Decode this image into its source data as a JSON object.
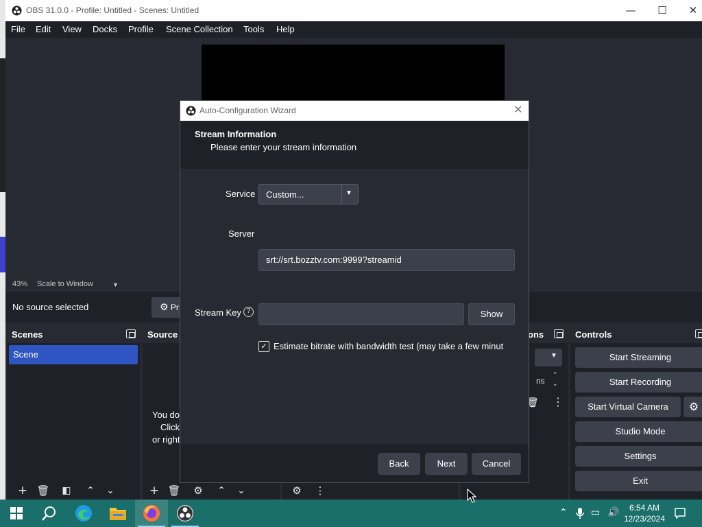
{
  "window": {
    "title": "OBS 31.0.0 - Profile: Untitled - Scenes: Untitled",
    "minimize": "—",
    "maximize": "☐",
    "close": "✕"
  },
  "menu": [
    "File",
    "Edit",
    "View",
    "Docks",
    "Profile",
    "Scene Collection",
    "Tools",
    "Help"
  ],
  "preview": {
    "zoom": "43%",
    "scale_mode": "Scale to Window",
    "caret": "▼"
  },
  "source_bar": {
    "no_source": "No source selected",
    "properties_partial": "Pr"
  },
  "docks": {
    "scenes_title": "Scenes",
    "scene_item": "Scene",
    "sources_title": "Source",
    "sources_empty": [
      "You do",
      "Click",
      "or right"
    ],
    "transitions_title_partial": "ons",
    "transitions_partial": "ns",
    "controls_title": "Controls"
  },
  "controls": {
    "start_streaming": "Start Streaming",
    "start_recording": "Start Recording",
    "start_virtual_camera": "Start Virtual Camera",
    "studio_mode": "Studio Mode",
    "settings": "Settings",
    "exit": "Exit"
  },
  "dialog": {
    "title": "Auto-Configuration Wizard",
    "close": "✕",
    "header_title": "Stream Information",
    "header_subtitle": "Please enter your stream information",
    "service_label": "Service",
    "service_value": "Custom...",
    "server_label": "Server",
    "server_value": "srt://srt.bozztv.com:9999?streamid",
    "stream_key_label": "Stream Key",
    "help_glyph": "?",
    "stream_key_value": "",
    "show_button": "Show",
    "bitrate_checked": true,
    "check_glyph": "✓",
    "bitrate_label": "Estimate bitrate with bandwidth test (may take a few minut",
    "back_button": "Back",
    "next_button": "Next",
    "cancel_button": "Cancel"
  },
  "taskbar": {
    "time": "6:54 AM",
    "date": "12/23/2024"
  },
  "colors": {
    "obs_bg": "#272a33",
    "obs_dark": "#1f2129",
    "button": "#3c404b",
    "scene_selected": "#2f55c2",
    "taskbar": "#1b6f6b"
  }
}
